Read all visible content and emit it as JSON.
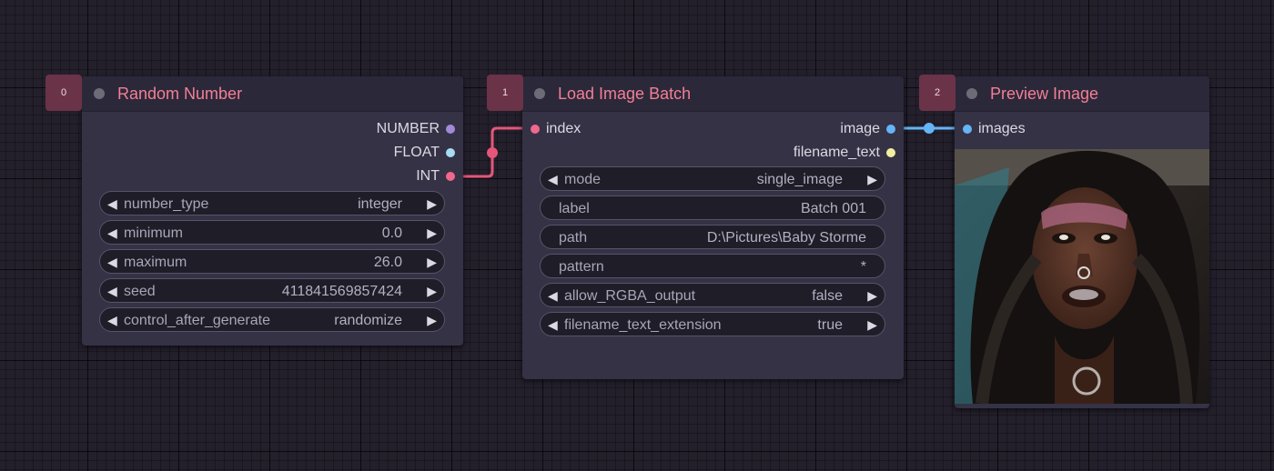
{
  "colors": {
    "link_int": "#e4567a",
    "link_image": "#64b5f6",
    "slot_number": "#a38ad8",
    "slot_float": "#a8dcf2",
    "slot_int": "#f0688c",
    "slot_image": "#64b5f6",
    "slot_text": "#f2f0a0"
  },
  "nodes": [
    {
      "id": "0",
      "title": "Random Number",
      "outputs": [
        "NUMBER",
        "FLOAT",
        "INT"
      ],
      "widgets": [
        {
          "label": "number_type",
          "value": "integer"
        },
        {
          "label": "minimum",
          "value": "0.0"
        },
        {
          "label": "maximum",
          "value": "26.0"
        },
        {
          "label": "seed",
          "value": "411841569857424"
        },
        {
          "label": "control_after_generate",
          "value": "randomize"
        }
      ]
    },
    {
      "id": "1",
      "title": "Load Image Batch",
      "inputs": [
        "index"
      ],
      "outputs": [
        "image",
        "filename_text"
      ],
      "widgets": [
        {
          "label": "mode",
          "value": "single_image"
        },
        {
          "label": "label",
          "value": "Batch 001"
        },
        {
          "label": "path",
          "value": "D:\\Pictures\\Baby Storme"
        },
        {
          "label": "pattern",
          "value": "*"
        },
        {
          "label": "allow_RGBA_output",
          "value": "false"
        },
        {
          "label": "filename_text_extension",
          "value": "true"
        }
      ]
    },
    {
      "id": "2",
      "title": "Preview Image",
      "inputs": [
        "images"
      ],
      "preview_icon": "portrait-photo-icon"
    }
  ]
}
